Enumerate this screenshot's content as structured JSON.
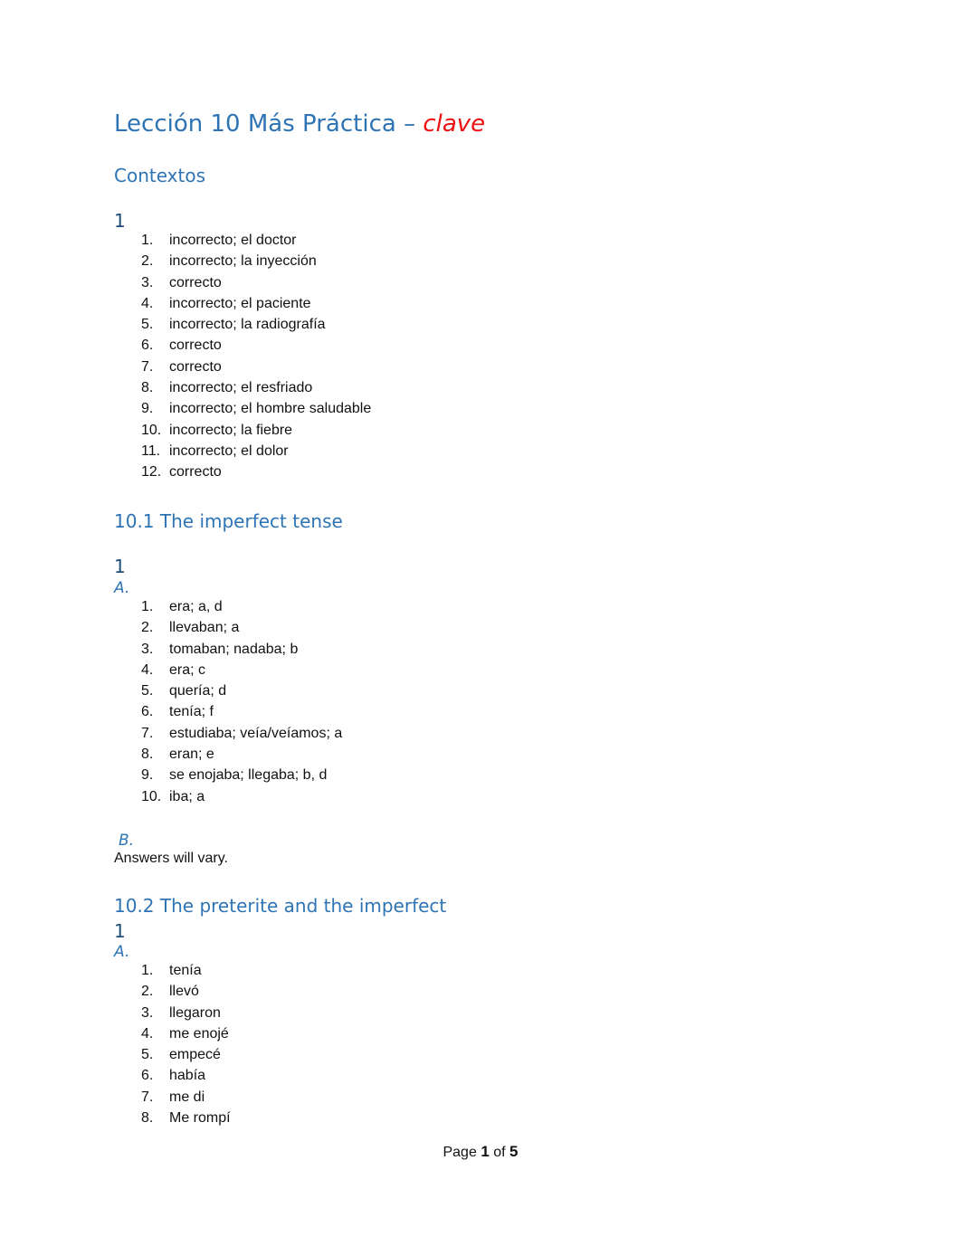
{
  "document": {
    "title": "Lección 10 Más Práctica",
    "title_separator": "–",
    "title_accent": "clave",
    "accent_color": "#ee1111",
    "heading_color": "#2e74b5"
  },
  "sections": [
    {
      "heading": "Contextos",
      "exercise": "1",
      "items": [
        {
          "num": "1.",
          "text": "incorrecto; el doctor"
        },
        {
          "num": "2.",
          "text": "incorrecto; la inyección"
        },
        {
          "num": "3.",
          "text": "correcto"
        },
        {
          "num": "4.",
          "text": "incorrecto; el paciente"
        },
        {
          "num": "5.",
          "text": "incorrecto; la radiografía"
        },
        {
          "num": "6.",
          "text": "correcto"
        },
        {
          "num": "7.",
          "text": "correcto"
        },
        {
          "num": "8.",
          "text": "incorrecto; el resfriado"
        },
        {
          "num": "9.",
          "text": "incorrecto; el hombre saludable"
        },
        {
          "num": "10.",
          "text": "incorrecto; la fiebre"
        },
        {
          "num": "11.",
          "text": "incorrecto; el dolor"
        },
        {
          "num": "12.",
          "text": "correcto"
        }
      ]
    },
    {
      "heading": "10.1 The imperfect tense",
      "exercise": "1",
      "part_a": "A.",
      "items": [
        {
          "num": "1.",
          "text": "era; a, d"
        },
        {
          "num": "2.",
          "text": "llevaban; a"
        },
        {
          "num": "3.",
          "text": "tomaban; nadaba; b"
        },
        {
          "num": "4.",
          "text": "era; c"
        },
        {
          "num": "5.",
          "text": "quería; d"
        },
        {
          "num": "6.",
          "text": "tenía; f"
        },
        {
          "num": "7.",
          "text": "estudiaba; veía/veíamos; a"
        },
        {
          "num": "8.",
          "text": "eran; e"
        },
        {
          "num": "9.",
          "text": "se enojaba; llegaba; b, d"
        },
        {
          "num": "10.",
          "text": "iba; a"
        }
      ],
      "part_b": "B.",
      "part_b_text": "Answers will vary."
    },
    {
      "heading": "10.2 The preterite and the imperfect",
      "exercise": "1",
      "part_a": "A.",
      "items": [
        {
          "num": "1.",
          "text": "tenía"
        },
        {
          "num": "2.",
          "text": "llevó"
        },
        {
          "num": "3.",
          "text": "llegaron"
        },
        {
          "num": "4.",
          "text": "me enojé"
        },
        {
          "num": "5.",
          "text": "empecé"
        },
        {
          "num": "6.",
          "text": "había"
        },
        {
          "num": "7.",
          "text": "me di"
        },
        {
          "num": "8.",
          "text": "Me rompí"
        }
      ]
    }
  ],
  "footer": {
    "page_label": "Page",
    "current_page": "1",
    "of_label": "of",
    "total_pages": "5"
  }
}
